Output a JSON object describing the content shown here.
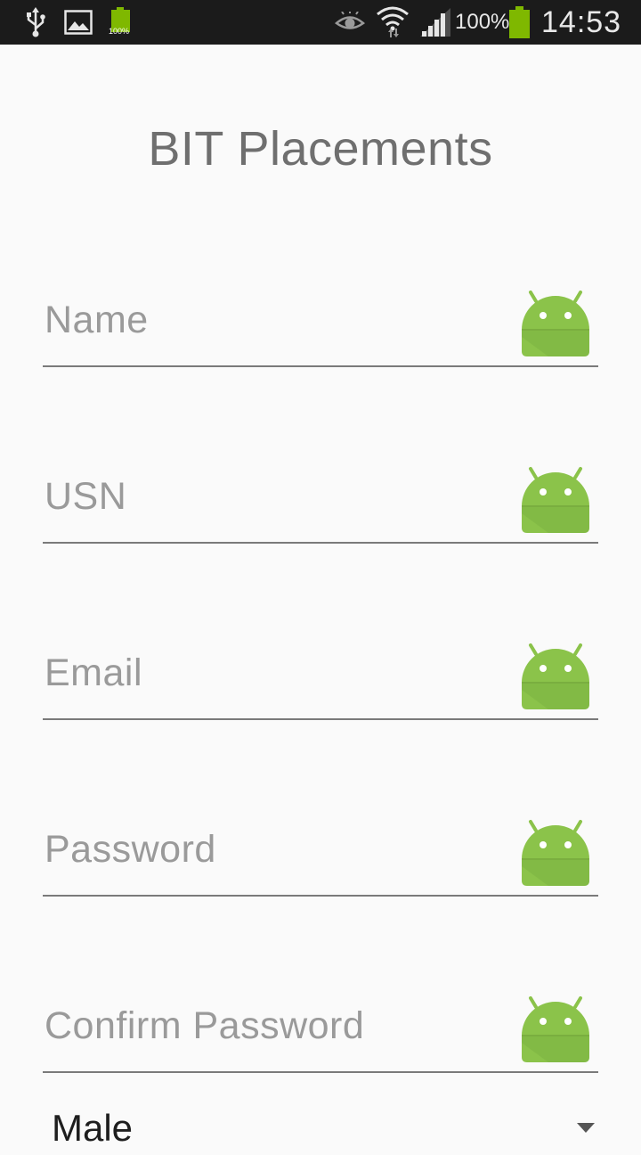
{
  "status_bar": {
    "battery_small_label": "100%",
    "battery_percent": "100%",
    "time": "14:53",
    "icons": [
      "usb-icon",
      "gallery-icon",
      "battery-small-icon",
      "eye-icon",
      "wifi-icon",
      "signal-icon",
      "battery-icon"
    ],
    "battery_color": "#7fb800"
  },
  "app": {
    "title": "BIT Placements"
  },
  "form": {
    "fields": [
      {
        "placeholder": "Name",
        "icon": "android-icon"
      },
      {
        "placeholder": "USN",
        "icon": "android-icon"
      },
      {
        "placeholder": "Email",
        "icon": "android-icon"
      },
      {
        "placeholder": "Password",
        "icon": "android-icon"
      },
      {
        "placeholder": "Confirm Password",
        "icon": "android-icon"
      }
    ],
    "gender": {
      "selected": "Male"
    },
    "android_icon_color": "#8bc34a"
  }
}
